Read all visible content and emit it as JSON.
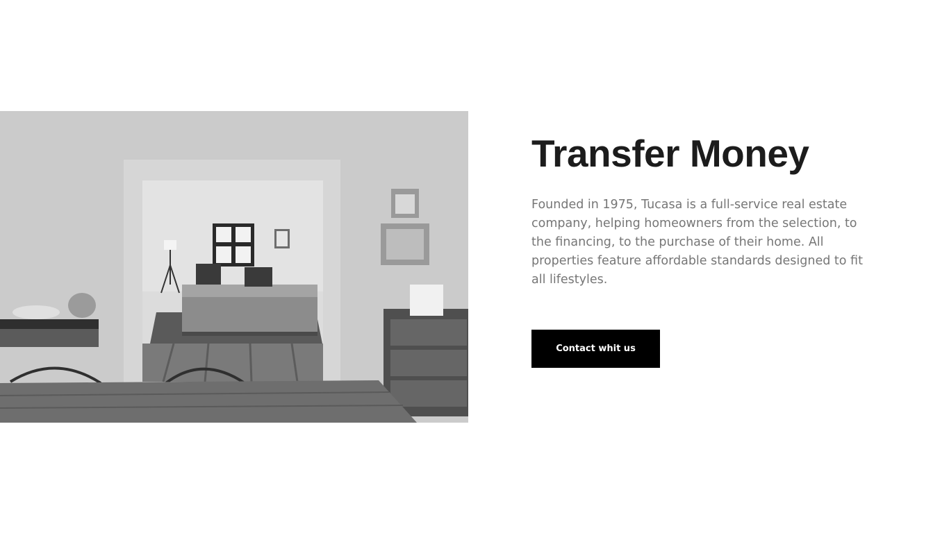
{
  "hero": {
    "title": "Transfer Money",
    "description": "Founded in 1975, Tucasa is a full-service real estate company, helping homeowners from the selection, to the financing, to the purchase of their home. All properties feature affordable standards designed to fit all lifestyles.",
    "cta_label": "Contact whit us"
  },
  "image": {
    "subject": "black-and-white interior photo of a living room seen through a doorway",
    "icon": "interior-photo"
  },
  "colors": {
    "background": "#ffffff",
    "title": "#1c1c1c",
    "body_text": "#767676",
    "button_bg": "#000000",
    "button_text": "#ffffff"
  }
}
